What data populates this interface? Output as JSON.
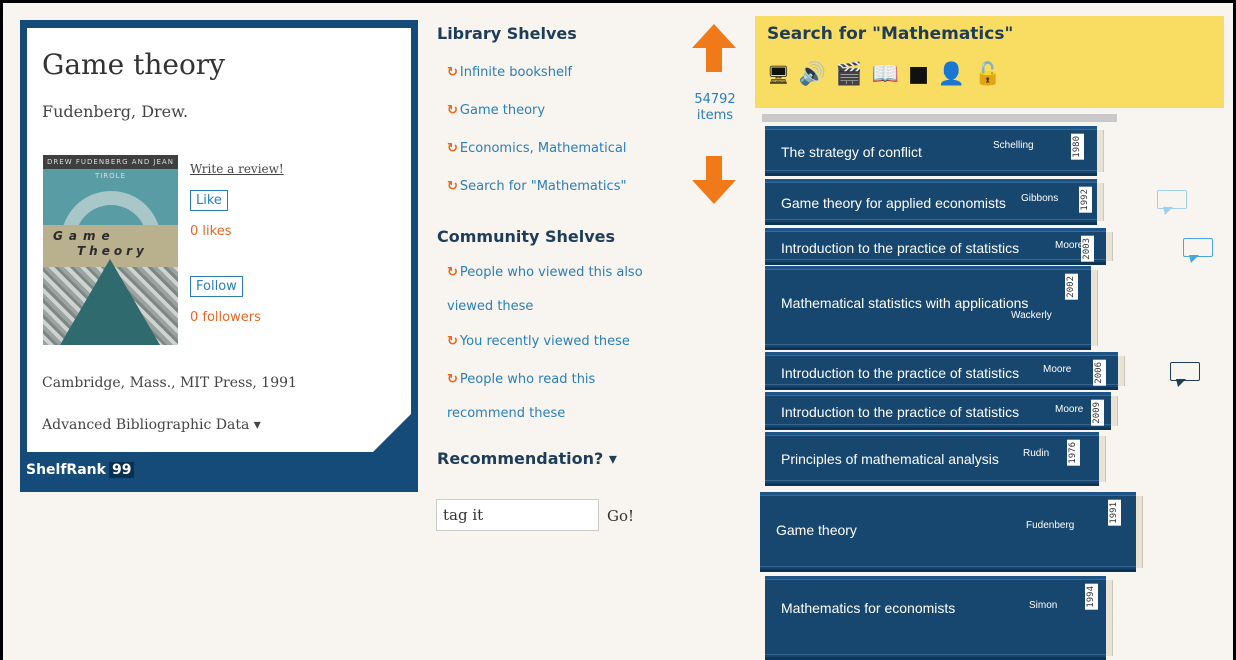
{
  "book": {
    "title": "Game theory",
    "author": "Fudenberg, Drew.",
    "cover_top_text": "DREW FUDENBERG AND JEAN TIROLE",
    "cover_word1": "Game",
    "cover_word2": "Theory",
    "write_review": "Write a review!",
    "like_label": "Like",
    "likes": "0 likes",
    "follow_label": "Follow",
    "followers": "0 followers",
    "publication": "Cambridge, Mass., MIT Press, 1991",
    "advanced": "Advanced Bibliographic Data ▾",
    "shelfrank_label": "ShelfRank",
    "shelfrank_value": "99"
  },
  "library_shelves": {
    "heading": "Library Shelves",
    "items": [
      "Infinite bookshelf",
      "Game theory",
      "Economics, Mathematical",
      "Search for \"Mathematics\""
    ]
  },
  "community_shelves": {
    "heading": "Community Shelves",
    "items": [
      "People who viewed this also viewed these",
      "You recently viewed these",
      "People who read this recommend these"
    ]
  },
  "recommendation": {
    "heading": "Recommendation? ▾",
    "input_value": "tag it",
    "go_label": "Go!"
  },
  "navigation": {
    "items_count_number": "54792",
    "items_count_label": "items"
  },
  "search_panel": {
    "title": "Search for \"Mathematics\"",
    "icons": [
      "computer-file-icon",
      "speaker-icon",
      "clapperboard-icon",
      "open-book-icon",
      "film-frame-icon",
      "reader-icon",
      "lock-icon"
    ]
  },
  "books": [
    {
      "title": "The strategy of conflict",
      "author": "Schelling",
      "year": "1980"
    },
    {
      "title": "Game theory for applied economists",
      "author": "Gibbons",
      "year": "1992"
    },
    {
      "title": "Introduction to the practice of statistics",
      "author": "Moore",
      "year": "2003"
    },
    {
      "title": "Mathematical statistics with applications",
      "author": "Wackerly",
      "year": "2002"
    },
    {
      "title": "Introduction to the practice of statistics",
      "author": "Moore",
      "year": "2006"
    },
    {
      "title": "Introduction to the practice of statistics",
      "author": "Moore",
      "year": "2009"
    },
    {
      "title": "Principles of mathematical analysis",
      "author": "Rudin",
      "year": "1976"
    },
    {
      "title": "Game theory",
      "author": "Fudenberg",
      "year": "1991"
    },
    {
      "title": "Mathematics for economists",
      "author": "Simon",
      "year": "1994"
    }
  ],
  "colors": {
    "accent_orange": "#e8661e",
    "link_blue": "#2a7fb8",
    "book_blue": "#17466f",
    "panel_yellow": "#f9dd63",
    "card_blue": "#154b78"
  }
}
